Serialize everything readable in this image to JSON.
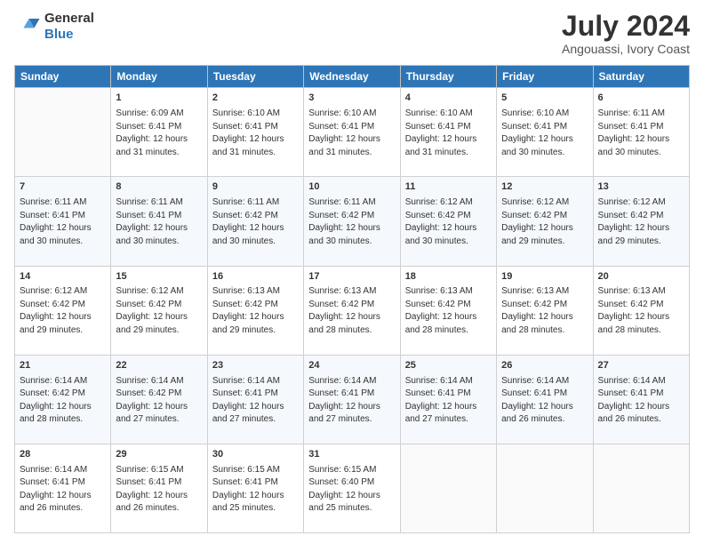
{
  "header": {
    "logo_line1": "General",
    "logo_line2": "Blue",
    "month": "July 2024",
    "location": "Angouassi, Ivory Coast"
  },
  "weekdays": [
    "Sunday",
    "Monday",
    "Tuesday",
    "Wednesday",
    "Thursday",
    "Friday",
    "Saturday"
  ],
  "weeks": [
    [
      {
        "day": "",
        "sunrise": "",
        "sunset": "",
        "daylight": ""
      },
      {
        "day": "1",
        "sunrise": "Sunrise: 6:09 AM",
        "sunset": "Sunset: 6:41 PM",
        "daylight": "Daylight: 12 hours and 31 minutes."
      },
      {
        "day": "2",
        "sunrise": "Sunrise: 6:10 AM",
        "sunset": "Sunset: 6:41 PM",
        "daylight": "Daylight: 12 hours and 31 minutes."
      },
      {
        "day": "3",
        "sunrise": "Sunrise: 6:10 AM",
        "sunset": "Sunset: 6:41 PM",
        "daylight": "Daylight: 12 hours and 31 minutes."
      },
      {
        "day": "4",
        "sunrise": "Sunrise: 6:10 AM",
        "sunset": "Sunset: 6:41 PM",
        "daylight": "Daylight: 12 hours and 31 minutes."
      },
      {
        "day": "5",
        "sunrise": "Sunrise: 6:10 AM",
        "sunset": "Sunset: 6:41 PM",
        "daylight": "Daylight: 12 hours and 30 minutes."
      },
      {
        "day": "6",
        "sunrise": "Sunrise: 6:11 AM",
        "sunset": "Sunset: 6:41 PM",
        "daylight": "Daylight: 12 hours and 30 minutes."
      }
    ],
    [
      {
        "day": "7",
        "sunrise": "Sunrise: 6:11 AM",
        "sunset": "Sunset: 6:41 PM",
        "daylight": "Daylight: 12 hours and 30 minutes."
      },
      {
        "day": "8",
        "sunrise": "Sunrise: 6:11 AM",
        "sunset": "Sunset: 6:41 PM",
        "daylight": "Daylight: 12 hours and 30 minutes."
      },
      {
        "day": "9",
        "sunrise": "Sunrise: 6:11 AM",
        "sunset": "Sunset: 6:42 PM",
        "daylight": "Daylight: 12 hours and 30 minutes."
      },
      {
        "day": "10",
        "sunrise": "Sunrise: 6:11 AM",
        "sunset": "Sunset: 6:42 PM",
        "daylight": "Daylight: 12 hours and 30 minutes."
      },
      {
        "day": "11",
        "sunrise": "Sunrise: 6:12 AM",
        "sunset": "Sunset: 6:42 PM",
        "daylight": "Daylight: 12 hours and 30 minutes."
      },
      {
        "day": "12",
        "sunrise": "Sunrise: 6:12 AM",
        "sunset": "Sunset: 6:42 PM",
        "daylight": "Daylight: 12 hours and 29 minutes."
      },
      {
        "day": "13",
        "sunrise": "Sunrise: 6:12 AM",
        "sunset": "Sunset: 6:42 PM",
        "daylight": "Daylight: 12 hours and 29 minutes."
      }
    ],
    [
      {
        "day": "14",
        "sunrise": "Sunrise: 6:12 AM",
        "sunset": "Sunset: 6:42 PM",
        "daylight": "Daylight: 12 hours and 29 minutes."
      },
      {
        "day": "15",
        "sunrise": "Sunrise: 6:12 AM",
        "sunset": "Sunset: 6:42 PM",
        "daylight": "Daylight: 12 hours and 29 minutes."
      },
      {
        "day": "16",
        "sunrise": "Sunrise: 6:13 AM",
        "sunset": "Sunset: 6:42 PM",
        "daylight": "Daylight: 12 hours and 29 minutes."
      },
      {
        "day": "17",
        "sunrise": "Sunrise: 6:13 AM",
        "sunset": "Sunset: 6:42 PM",
        "daylight": "Daylight: 12 hours and 28 minutes."
      },
      {
        "day": "18",
        "sunrise": "Sunrise: 6:13 AM",
        "sunset": "Sunset: 6:42 PM",
        "daylight": "Daylight: 12 hours and 28 minutes."
      },
      {
        "day": "19",
        "sunrise": "Sunrise: 6:13 AM",
        "sunset": "Sunset: 6:42 PM",
        "daylight": "Daylight: 12 hours and 28 minutes."
      },
      {
        "day": "20",
        "sunrise": "Sunrise: 6:13 AM",
        "sunset": "Sunset: 6:42 PM",
        "daylight": "Daylight: 12 hours and 28 minutes."
      }
    ],
    [
      {
        "day": "21",
        "sunrise": "Sunrise: 6:14 AM",
        "sunset": "Sunset: 6:42 PM",
        "daylight": "Daylight: 12 hours and 28 minutes."
      },
      {
        "day": "22",
        "sunrise": "Sunrise: 6:14 AM",
        "sunset": "Sunset: 6:42 PM",
        "daylight": "Daylight: 12 hours and 27 minutes."
      },
      {
        "day": "23",
        "sunrise": "Sunrise: 6:14 AM",
        "sunset": "Sunset: 6:41 PM",
        "daylight": "Daylight: 12 hours and 27 minutes."
      },
      {
        "day": "24",
        "sunrise": "Sunrise: 6:14 AM",
        "sunset": "Sunset: 6:41 PM",
        "daylight": "Daylight: 12 hours and 27 minutes."
      },
      {
        "day": "25",
        "sunrise": "Sunrise: 6:14 AM",
        "sunset": "Sunset: 6:41 PM",
        "daylight": "Daylight: 12 hours and 27 minutes."
      },
      {
        "day": "26",
        "sunrise": "Sunrise: 6:14 AM",
        "sunset": "Sunset: 6:41 PM",
        "daylight": "Daylight: 12 hours and 26 minutes."
      },
      {
        "day": "27",
        "sunrise": "Sunrise: 6:14 AM",
        "sunset": "Sunset: 6:41 PM",
        "daylight": "Daylight: 12 hours and 26 minutes."
      }
    ],
    [
      {
        "day": "28",
        "sunrise": "Sunrise: 6:14 AM",
        "sunset": "Sunset: 6:41 PM",
        "daylight": "Daylight: 12 hours and 26 minutes."
      },
      {
        "day": "29",
        "sunrise": "Sunrise: 6:15 AM",
        "sunset": "Sunset: 6:41 PM",
        "daylight": "Daylight: 12 hours and 26 minutes."
      },
      {
        "day": "30",
        "sunrise": "Sunrise: 6:15 AM",
        "sunset": "Sunset: 6:41 PM",
        "daylight": "Daylight: 12 hours and 25 minutes."
      },
      {
        "day": "31",
        "sunrise": "Sunrise: 6:15 AM",
        "sunset": "Sunset: 6:40 PM",
        "daylight": "Daylight: 12 hours and 25 minutes."
      },
      {
        "day": "",
        "sunrise": "",
        "sunset": "",
        "daylight": ""
      },
      {
        "day": "",
        "sunrise": "",
        "sunset": "",
        "daylight": ""
      },
      {
        "day": "",
        "sunrise": "",
        "sunset": "",
        "daylight": ""
      }
    ]
  ]
}
